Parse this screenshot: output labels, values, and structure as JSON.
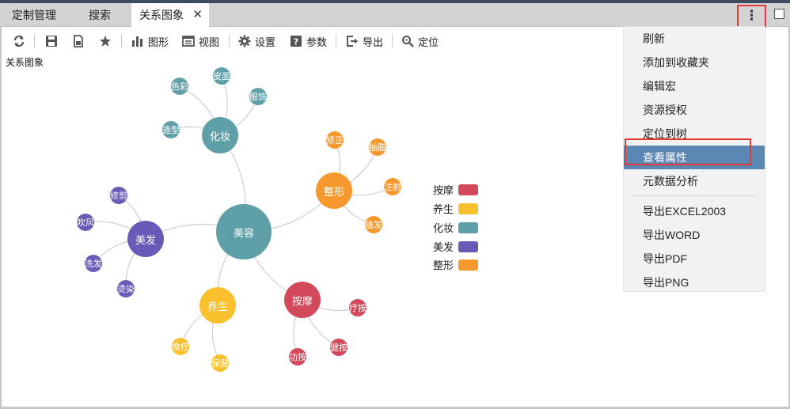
{
  "tabs": [
    {
      "label": "定制管理",
      "active": false
    },
    {
      "label": "搜索",
      "active": false
    },
    {
      "label": "关系图象",
      "active": true
    }
  ],
  "tab_close_glyph": "✕",
  "more_glyph": "⋮",
  "toolbar": {
    "refresh_icon": "refresh-icon",
    "save_icon": "save-icon",
    "save_as_icon": "save-as-icon",
    "favorite_icon": "star-icon",
    "chart_label": "图形",
    "view_label": "视图",
    "settings_label": "设置",
    "params_label": "参数",
    "export_label": "导出",
    "locate_label": "定位"
  },
  "page_subtitle": "关系图象",
  "graph": {
    "root": "美容",
    "categories": [
      {
        "name": "按摩",
        "color": "#d1495b",
        "children": [
          "疗按",
          "健按",
          "功按"
        ]
      },
      {
        "name": "养生",
        "color": "#fbc02d",
        "children": [
          "食疗",
          "保健"
        ]
      },
      {
        "name": "化妆",
        "color": "#5fa0a8",
        "children": [
          "色彩",
          "皮面",
          "服饰",
          "造型"
        ]
      },
      {
        "name": "美发",
        "color": "#6a5ab7",
        "children": [
          "修剪",
          "吹风",
          "洗发",
          "烫染"
        ]
      },
      {
        "name": "整形",
        "color": "#f7992f",
        "children": [
          "矫正",
          "抽脂",
          "注射",
          "植发"
        ]
      }
    ],
    "root_color": "#5fa0a8",
    "link_color": "#cfcfcf"
  },
  "menu": {
    "items": [
      "刷新",
      "添加到收藏夹",
      "编辑宏",
      "资源授权",
      "定位到树",
      "查看属性",
      "元数据分析"
    ],
    "export_items": [
      "导出EXCEL2003",
      "导出WORD",
      "导出PDF",
      "导出PNG"
    ],
    "active_item": "查看属性"
  }
}
